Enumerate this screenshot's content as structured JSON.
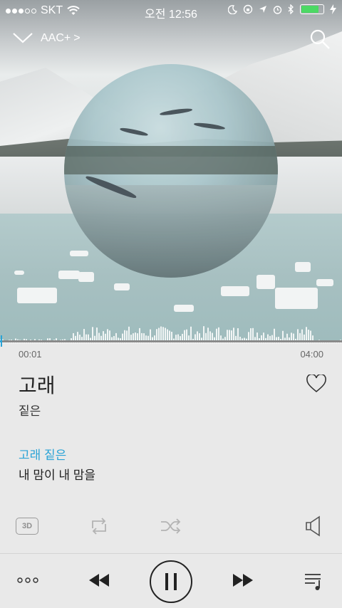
{
  "status": {
    "carrier": "SKT",
    "time": "오전 12:56",
    "battery_color": "#4cd964"
  },
  "header": {
    "codec_label": "AAC+",
    "codec_chevron": ">"
  },
  "player": {
    "current_time": "00:01",
    "total_time": "04:00",
    "progress_fraction": 0.004,
    "title": "고래",
    "artist": "짙은",
    "lyric_active": "고래 짙은",
    "lyric_next": "내 맘이 내 맘을",
    "badge_3d": "3D",
    "accent_color": "#2aa3d6"
  },
  "icons": {
    "down": "chevron-down-icon",
    "search": "search-icon",
    "heart": "heart-icon",
    "repeat": "repeat-icon",
    "shuffle": "shuffle-icon",
    "speaker": "speaker-icon",
    "more": "more-icon",
    "rewind": "rewind-icon",
    "pause": "pause-icon",
    "fast_forward": "fast-forward-icon",
    "queue": "queue-icon"
  }
}
